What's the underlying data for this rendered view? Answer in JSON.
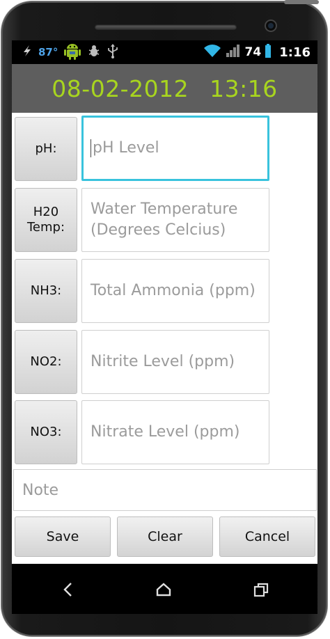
{
  "status_bar": {
    "temperature": "87°",
    "battery": "74",
    "time": "1:16",
    "icons": [
      "bolt-icon",
      "android-icon",
      "bug-icon",
      "usb-icon",
      "wifi-icon",
      "signal-icon",
      "battery-icon"
    ]
  },
  "header": {
    "date": "08-02-2012",
    "time": "13:16",
    "color": "#a8d51f"
  },
  "form": {
    "rows": [
      {
        "label": "pH:",
        "placeholder": "pH Level"
      },
      {
        "label": "H20\nTemp:",
        "placeholder": "Water Temperature (Degrees Celcius)"
      },
      {
        "label": "NH3:",
        "placeholder": "Total Ammonia (ppm)"
      },
      {
        "label": "NO2:",
        "placeholder": "Nitrite Level (ppm)"
      },
      {
        "label": "NO3:",
        "placeholder": "Nitrate Level (ppm)"
      }
    ],
    "note_placeholder": "Note",
    "focus_color": "#39c3dd"
  },
  "actions": {
    "save": "Save",
    "clear": "Clear",
    "cancel": "Cancel"
  },
  "nav": {
    "icons": [
      "back-icon",
      "home-icon",
      "recent-apps-icon"
    ]
  }
}
